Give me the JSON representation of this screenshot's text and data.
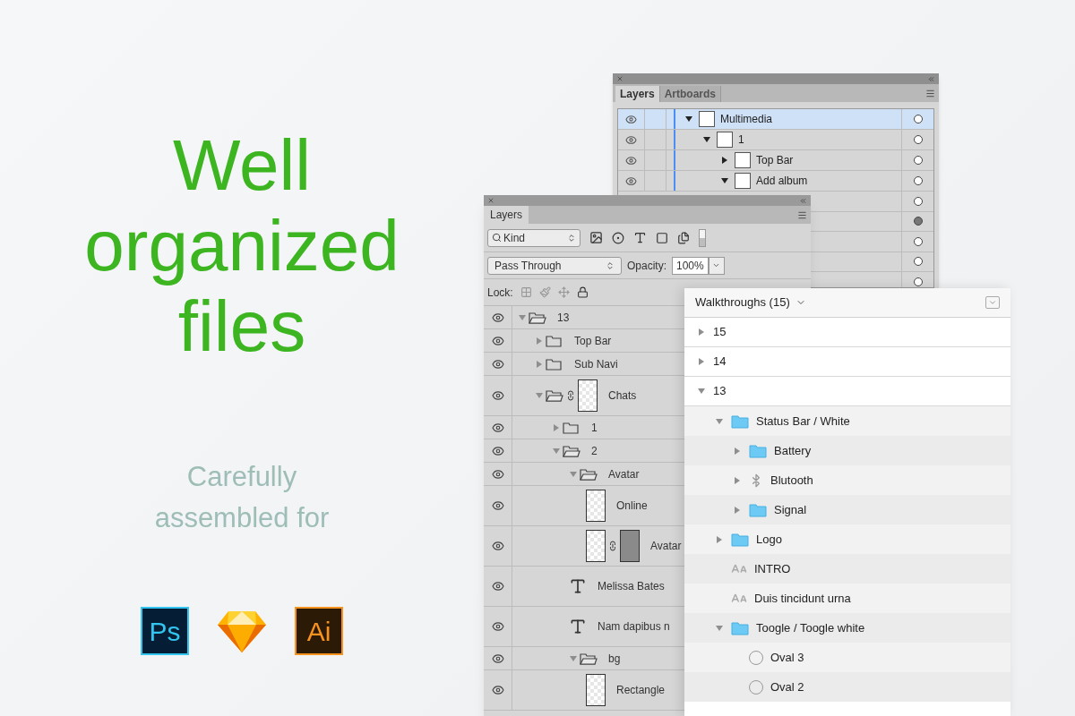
{
  "headline": [
    "Well",
    "organized",
    "files"
  ],
  "subtitle": [
    "Carefully",
    "assembled for"
  ],
  "apps": [
    {
      "kind": "photoshop",
      "label": "Ps"
    },
    {
      "kind": "sketch"
    },
    {
      "kind": "illustrator",
      "label": "Ai"
    }
  ],
  "illustrator_panel": {
    "tabs": [
      {
        "label": "Layers",
        "selected": true
      },
      {
        "label": "Artboards",
        "selected": false
      }
    ],
    "layers": [
      {
        "name": "Multimedia",
        "selected": true,
        "expanded": true,
        "targeted": false,
        "children": [
          {
            "name": "1",
            "selected": false,
            "expanded": true,
            "targeted": false,
            "children": [
              {
                "name": "Top Bar",
                "selected": false,
                "expanded": false,
                "targeted": false
              },
              {
                "name": "Add album",
                "selected": false,
                "expanded": true,
                "targeted": false
              }
            ]
          }
        ]
      }
    ],
    "hidden_rows": [
      {
        "targeted": false
      },
      {
        "targeted": true
      },
      {
        "targeted": false
      },
      {
        "targeted": false
      },
      {
        "targeted": false
      }
    ]
  },
  "photoshop_panel": {
    "tabs": [
      {
        "label": "Layers",
        "selected": true
      }
    ],
    "filter": "Kind",
    "blend_mode": "Pass Through",
    "opacity_label": "Opacity:",
    "opacity": "100%",
    "lock_label": "Lock:",
    "layers": [
      {
        "name": "13",
        "kind": "group",
        "expanded": true,
        "children": [
          {
            "name": "Top Bar",
            "kind": "group",
            "expanded": false
          },
          {
            "name": "Sub Navi",
            "kind": "group",
            "expanded": false
          },
          {
            "name": "Chats",
            "kind": "masked-group",
            "expanded": true,
            "children": [
              {
                "name": "1",
                "kind": "group",
                "expanded": false
              },
              {
                "name": "2",
                "kind": "group",
                "expanded": true,
                "children": [
                  {
                    "name": "Avatar",
                    "kind": "group",
                    "expanded": true,
                    "children": [
                      {
                        "name": "Online",
                        "kind": "shape"
                      },
                      {
                        "name": "Avatar",
                        "kind": "linked"
                      }
                    ]
                  },
                  {
                    "name": "Melissa Bates",
                    "kind": "text"
                  },
                  {
                    "name": "Nam dapibus n",
                    "kind": "text"
                  },
                  {
                    "name": "bg",
                    "kind": "group",
                    "expanded": true,
                    "children": [
                      {
                        "name": "Rectangle",
                        "kind": "shape"
                      }
                    ]
                  }
                ]
              }
            ]
          }
        ]
      }
    ]
  },
  "sketch_panel": {
    "title": "Walkthroughs (15)",
    "layers": [
      {
        "name": "15",
        "kind": "artboard",
        "expanded": false
      },
      {
        "name": "14",
        "kind": "artboard",
        "expanded": false
      },
      {
        "name": "13",
        "kind": "artboard",
        "expanded": true,
        "children": [
          {
            "name": "Status Bar / White",
            "kind": "folder",
            "expanded": true,
            "children": [
              {
                "name": "Battery",
                "kind": "folder",
                "expanded": false
              },
              {
                "name": "Blutooth",
                "kind": "symbol",
                "expanded": false
              },
              {
                "name": "Signal",
                "kind": "folder",
                "expanded": false
              }
            ]
          },
          {
            "name": "Logo",
            "kind": "folder",
            "expanded": false
          },
          {
            "name": "INTRO",
            "kind": "text"
          },
          {
            "name": "Duis tincidunt urna",
            "kind": "text"
          },
          {
            "name": "Toogle / Toogle white",
            "kind": "folder",
            "expanded": true,
            "children": [
              {
                "name": "Oval 3",
                "kind": "oval"
              },
              {
                "name": "Oval 2",
                "kind": "oval"
              }
            ]
          }
        ]
      }
    ]
  }
}
